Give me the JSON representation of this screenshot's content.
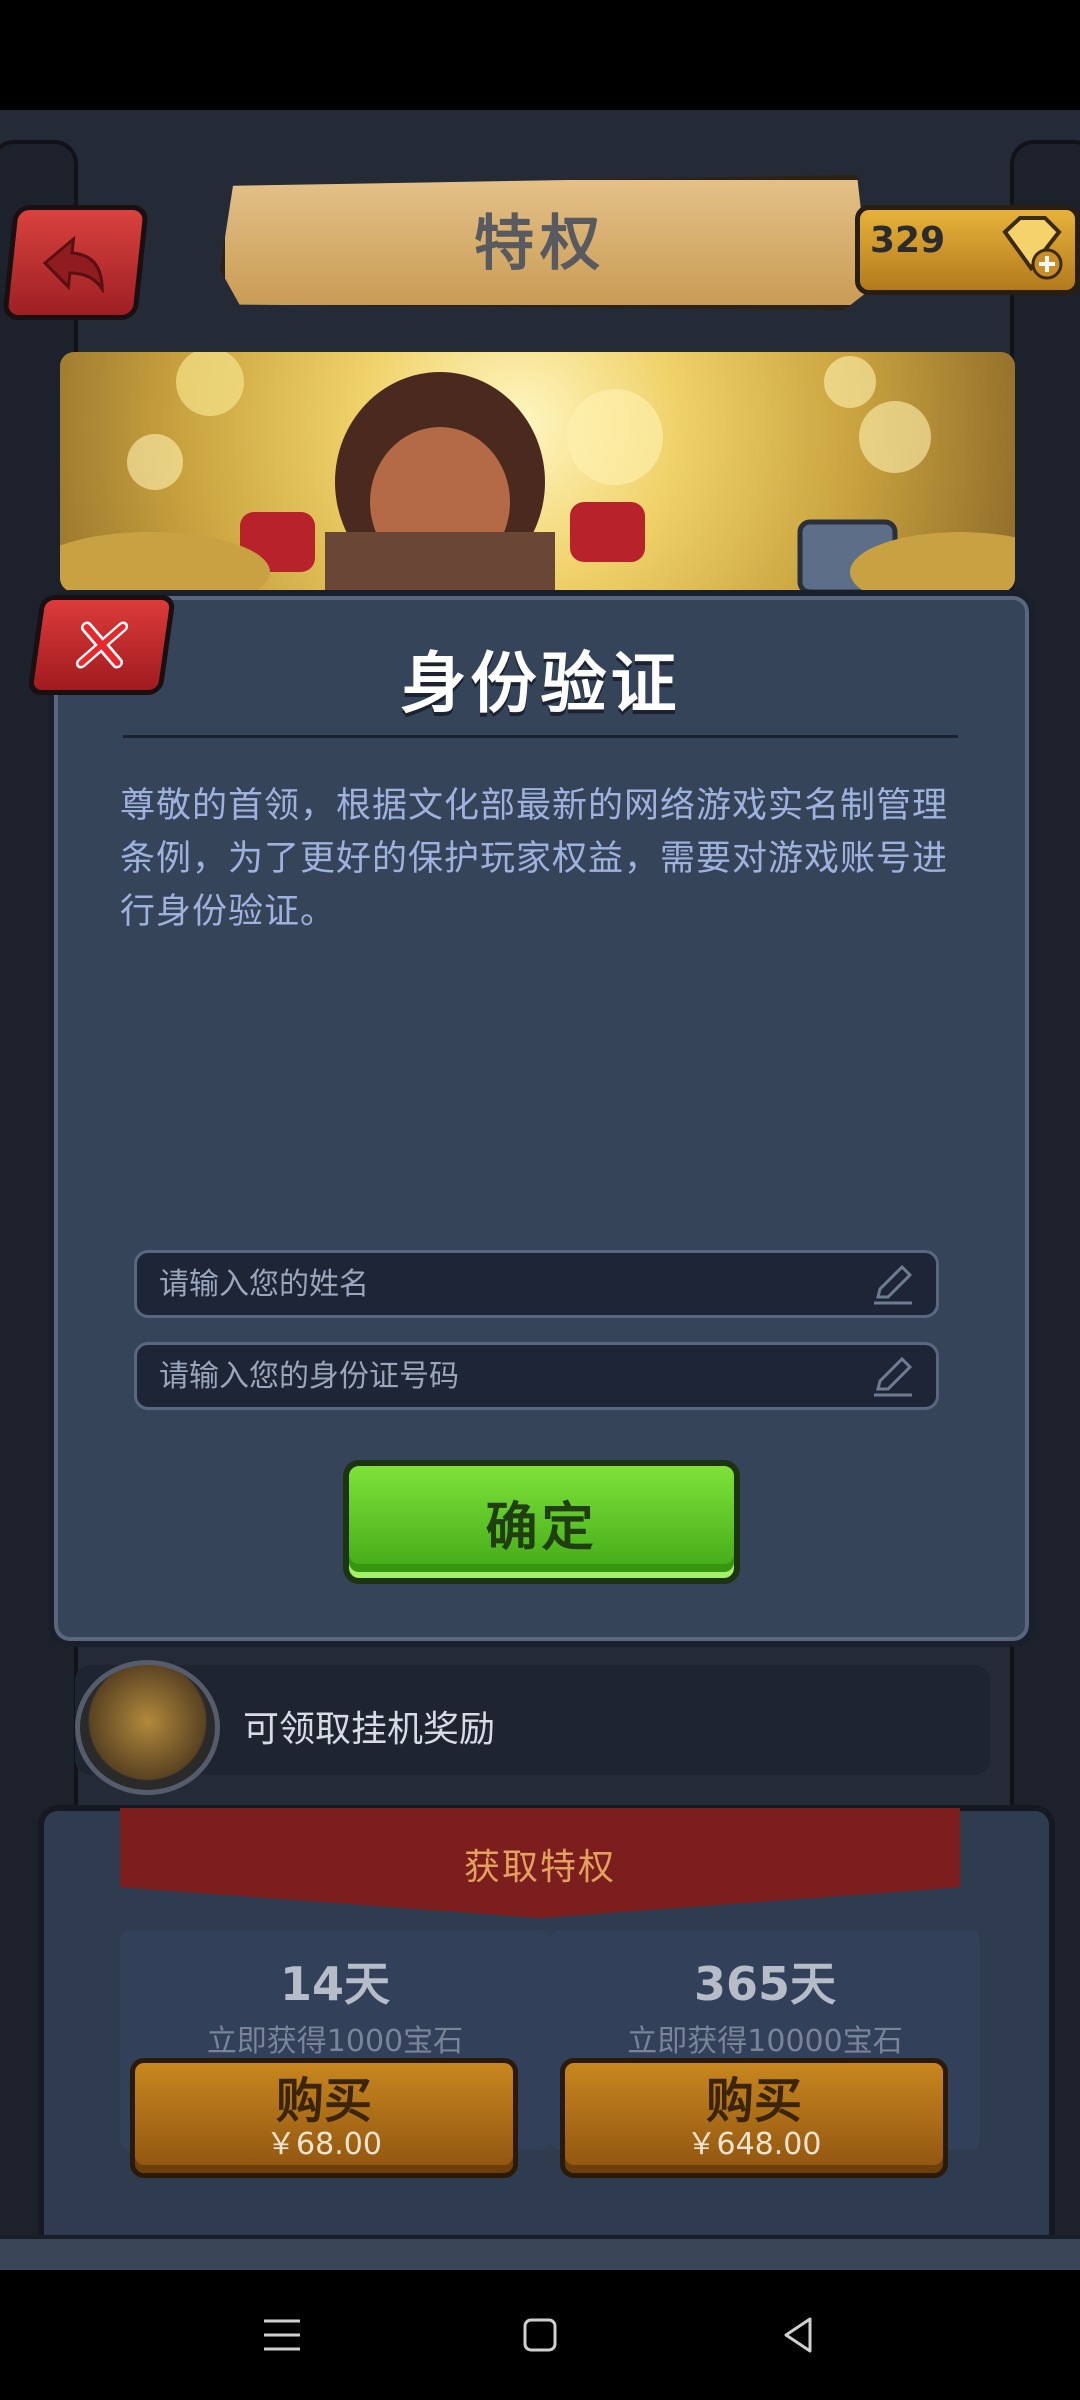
{
  "header": {
    "title": "特权",
    "gems": "329"
  },
  "dialog": {
    "title": "身份验证",
    "description": "尊敬的首领，根据文化部最新的网络游戏实名制管理条例，为了更好的保护玩家权益，需要对游戏账号进行身份验证。",
    "name_placeholder": "请输入您的姓名",
    "id_placeholder": "请输入您的身份证号码",
    "confirm_label": "确定"
  },
  "reward": {
    "text": "可领取挂机奖励"
  },
  "privilege": {
    "title": "获取特权",
    "offers": [
      {
        "days": "14天",
        "gift": "立即获得1000宝石",
        "buy_label": "购买",
        "price": "￥68.00"
      },
      {
        "days": "365天",
        "gift": "立即获得10000宝石",
        "buy_label": "购买",
        "price": "￥648.00"
      }
    ]
  },
  "nav": {
    "menu_icon": "menu-icon",
    "home_icon": "home-square-icon",
    "back_icon": "back-triangle-icon"
  },
  "colors": {
    "panel": "#36445a",
    "confirm_green": "#5cc428",
    "close_red": "#c72e30",
    "buy_orange": "#b5761a"
  }
}
